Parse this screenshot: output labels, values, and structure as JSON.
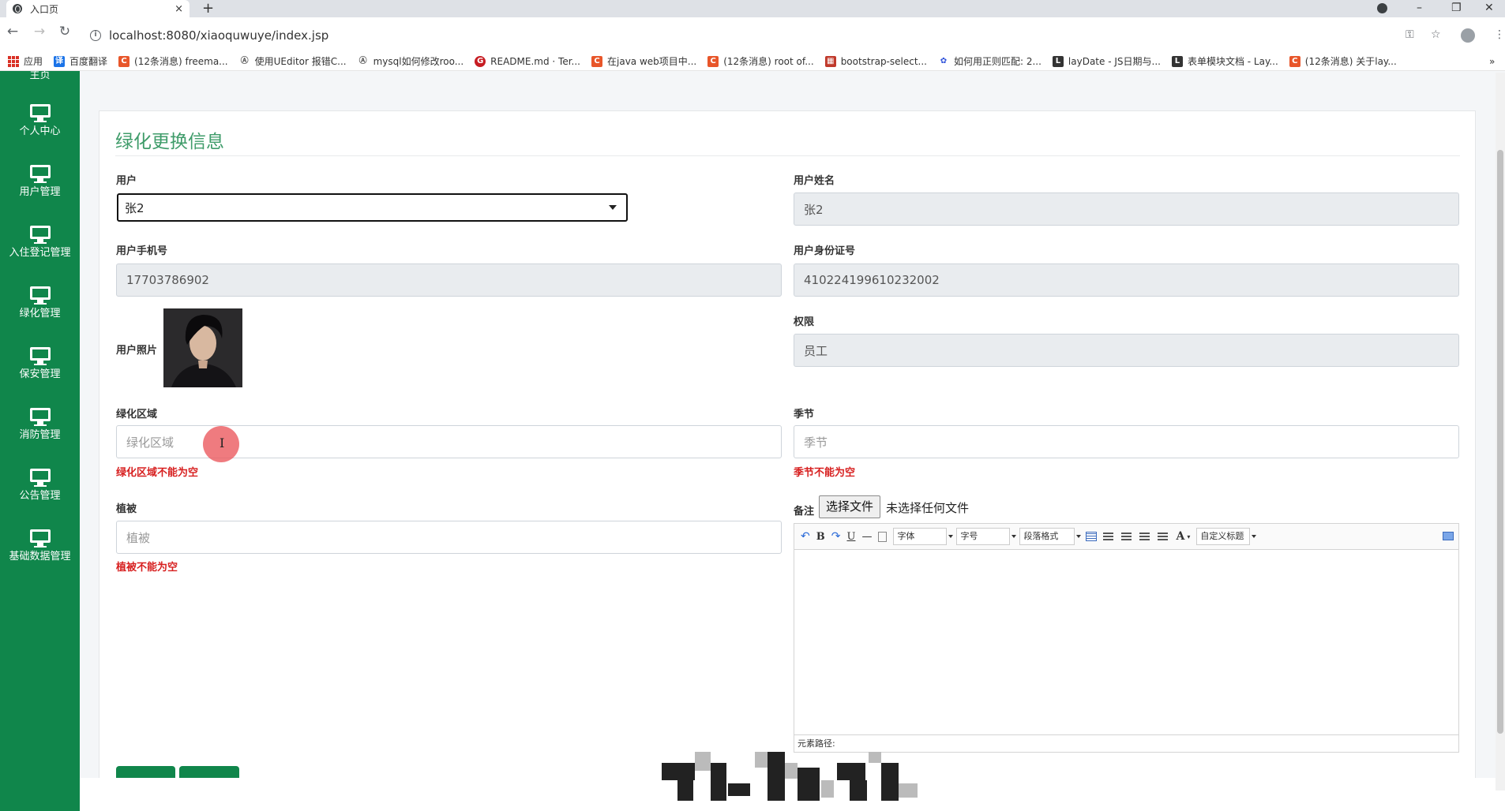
{
  "browser": {
    "tab_title": "入口页",
    "tab_close": "×",
    "new_tab": "+",
    "url": "localhost:8080/xiaoquwuye/index.jsp",
    "window_controls": [
      "–",
      "❐",
      "✕"
    ],
    "bookmarks": [
      {
        "label": "应用",
        "color": "#d93025"
      },
      {
        "label": "百度翻译",
        "color": "#1a73e8"
      },
      {
        "label": "(12条消息) freema...",
        "color": "#e8562a"
      },
      {
        "label": "使用UEditor 报错C...",
        "color": "#555555"
      },
      {
        "label": "mysql如何修改roo...",
        "color": "#555555"
      },
      {
        "label": "README.md · Ter...",
        "color": "#c71d23"
      },
      {
        "label": "在java web项目中...",
        "color": "#e8562a"
      },
      {
        "label": "(12条消息) root of...",
        "color": "#e8562a"
      },
      {
        "label": "bootstrap-select...",
        "color": "#c0392b"
      },
      {
        "label": "如何用正则匹配: 2...",
        "color": "#2b4fd9"
      },
      {
        "label": "layDate - JS日期与...",
        "color": "#333333"
      },
      {
        "label": "表单模块文档 - Lay...",
        "color": "#333333"
      },
      {
        "label": "(12条消息) 关于lay...",
        "color": "#e8562a"
      }
    ],
    "bookmark_more": "»"
  },
  "sidebar": {
    "partial_top": "主页",
    "items": [
      {
        "label": "个人中心"
      },
      {
        "label": "用户管理"
      },
      {
        "label": "入住登记管理"
      },
      {
        "label": "绿化管理"
      },
      {
        "label": "保安管理"
      },
      {
        "label": "消防管理"
      },
      {
        "label": "公告管理"
      },
      {
        "label": "基础数据管理"
      }
    ],
    "color": "#10864b"
  },
  "form": {
    "title": "绿化更换信息",
    "user": {
      "label": "用户",
      "value": "张2"
    },
    "user_name": {
      "label": "用户姓名",
      "value": "张2"
    },
    "user_phone": {
      "label": "用户手机号",
      "value": "17703786902"
    },
    "user_id_card": {
      "label": "用户身份证号",
      "value": "410224199610232002"
    },
    "user_photo": {
      "label": "用户照片"
    },
    "permission": {
      "label": "权限",
      "value": "员工"
    },
    "green_area": {
      "label": "绿化区域",
      "placeholder": "绿化区域",
      "error": "绿化区域不能为空"
    },
    "season": {
      "label": "季节",
      "placeholder": "季节",
      "error": "季节不能为空"
    },
    "vegetation": {
      "label": "植被",
      "placeholder": "植被",
      "error": "植被不能为空"
    },
    "remark": {
      "label": "备注",
      "file_button": "选择文件",
      "file_status": "未选择任何文件",
      "toolbar": {
        "font": "字体",
        "size": "字号",
        "paragraph": "段落格式",
        "custom_title": "自定义标题"
      },
      "status_path": "元素路径:"
    }
  },
  "colors": {
    "accent": "#10864b",
    "title": "#3f9c6a",
    "error": "#d71f1f"
  }
}
